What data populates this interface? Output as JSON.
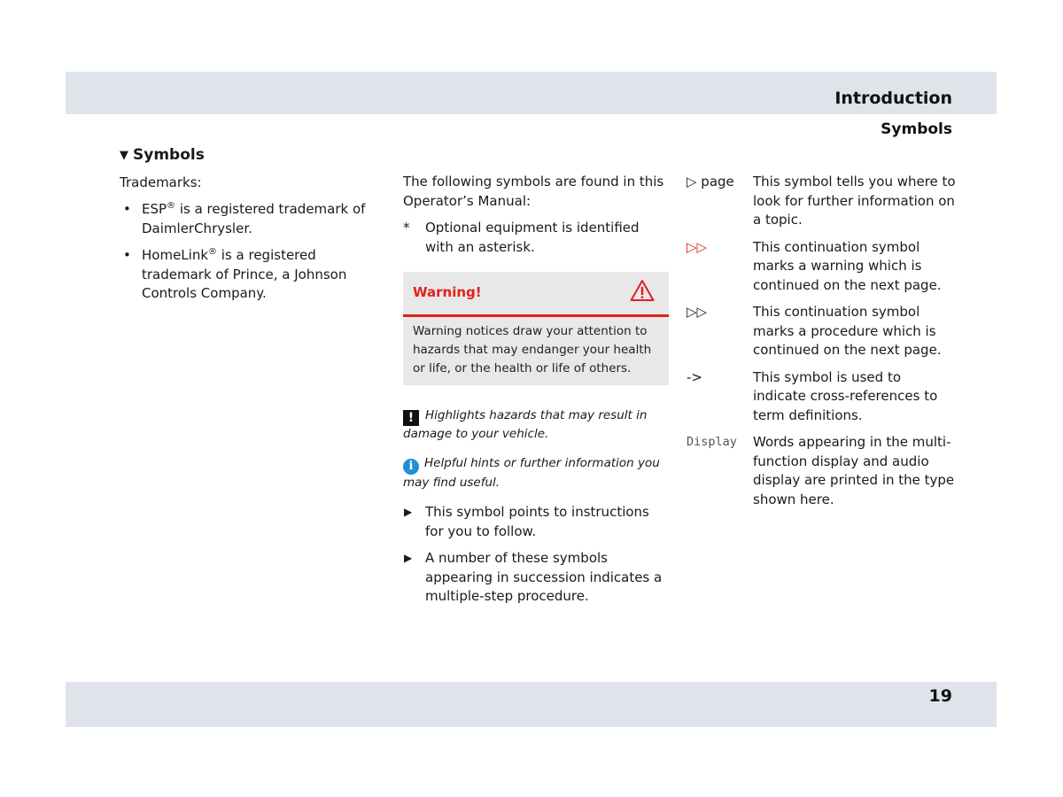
{
  "header": {
    "chapter": "Introduction",
    "section": "Symbols"
  },
  "footer": {
    "page_number": "19"
  },
  "left": {
    "heading": "Symbols",
    "intro": "Trademarks:",
    "items": [
      {
        "prefix": "ESP",
        "mark": "®",
        "text": " is a registered trademark of DaimlerChrysler."
      },
      {
        "prefix": "HomeLink",
        "mark": "®",
        "text": " is a registered trademark of Prince, a Johnson Controls Company."
      }
    ]
  },
  "middle": {
    "intro": "The following symbols are found in this Operator’s Manual:",
    "asterisk": {
      "symbol": "*",
      "text": "Optional equipment is identified with an asterisk."
    },
    "warning": {
      "title": "Warning!",
      "body": "Warning notices draw your attention to hazards that may endanger your health or life, or the health or life of others."
    },
    "notes": [
      {
        "icon": "!",
        "text": "Highlights hazards that may result in damage to your vehicle."
      },
      {
        "icon": "i",
        "text": "Helpful hints or further information you may find useful."
      }
    ],
    "steps": [
      {
        "icon": "▶",
        "text": "This symbol points to instructions for you to follow."
      },
      {
        "icon": "▶",
        "text": "A number of these symbols appearing in succession indicates a multiple-step procedure."
      }
    ]
  },
  "right": {
    "definitions": [
      {
        "term": "▷ page",
        "desc": "This symbol tells you where to look for further information on a topic.",
        "style": ""
      },
      {
        "term": "▷▷",
        "desc": "This continuation symbol marks a warning which is continued on the next page.",
        "style": "red"
      },
      {
        "term": "▷▷",
        "desc": "This continuation symbol marks a procedure which is continued on the next page.",
        "style": ""
      },
      {
        "term": "->",
        "desc": "This symbol is used to indicate cross-references to term definitions.",
        "style": ""
      },
      {
        "term": "Display",
        "desc": "Words appearing in the multi-function display and audio display are printed in the type shown here.",
        "style": "mono"
      }
    ]
  },
  "colors": {
    "band": "#dfe3ea",
    "warning_red": "#e2201c",
    "info_blue": "#1f8fd6",
    "box_gray": "#e8e8e8"
  }
}
